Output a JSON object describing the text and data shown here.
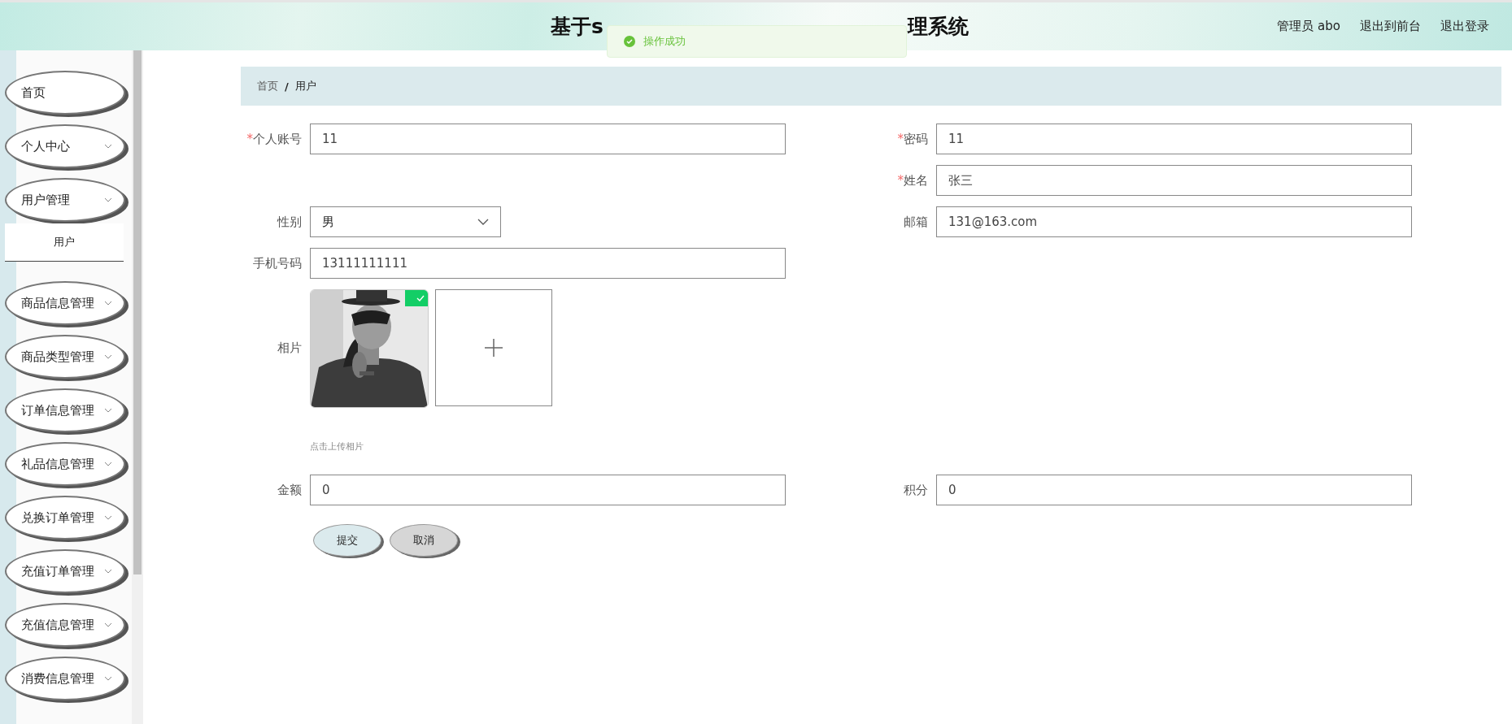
{
  "header": {
    "title_parts": [
      "基于s",
      "理系统"
    ],
    "user_label": "管理员 abo",
    "links": [
      "退出到前台",
      "退出登录"
    ]
  },
  "toast": {
    "message": "操作成功"
  },
  "sidebar": {
    "items": [
      {
        "label": "首页",
        "kind": "link"
      },
      {
        "label": "个人中心",
        "kind": "menu"
      },
      {
        "label": "用户管理",
        "kind": "menu",
        "children": [
          {
            "label": "用户"
          }
        ]
      },
      {
        "label": "商品信息管理",
        "kind": "menu"
      },
      {
        "label": "商品类型管理",
        "kind": "menu"
      },
      {
        "label": "订单信息管理",
        "kind": "menu"
      },
      {
        "label": "礼品信息管理",
        "kind": "menu"
      },
      {
        "label": "兑换订单管理",
        "kind": "menu"
      },
      {
        "label": "充值订单管理",
        "kind": "menu"
      },
      {
        "label": "充值信息管理",
        "kind": "menu"
      },
      {
        "label": "消费信息管理",
        "kind": "menu"
      }
    ]
  },
  "breadcrumb": {
    "items": [
      "首页",
      "用户"
    ],
    "separator": "/"
  },
  "form": {
    "rows": [
      {
        "left": [
          {
            "kind": "text",
            "label": "个人账号",
            "required_mark": "*",
            "value": "11"
          }
        ],
        "right": [
          {
            "kind": "text",
            "label": "密码",
            "required_mark": "*",
            "value": "11"
          },
          {
            "kind": "text",
            "label": "姓名",
            "required_mark": "*",
            "value": "张三"
          }
        ]
      },
      {
        "left": [
          {
            "kind": "select",
            "label": "性别",
            "value": "男"
          }
        ],
        "right": [
          {
            "kind": "text",
            "label": "邮箱",
            "value": "131@163.com"
          }
        ]
      },
      {
        "left": [
          {
            "kind": "text",
            "label": "手机号码",
            "value": "13111111111"
          }
        ]
      },
      {
        "left": [
          {
            "kind": "upload",
            "label": "相片",
            "uploaded": true,
            "hint": "点击上传相片"
          }
        ]
      },
      {
        "left": [
          {
            "kind": "text",
            "label": "金额",
            "value": "0"
          }
        ],
        "right": [
          {
            "kind": "text",
            "label": "积分",
            "value": "0"
          }
        ]
      }
    ],
    "buttons": [
      {
        "label": "提交",
        "kind": "primary"
      },
      {
        "label": "取消",
        "kind": "secondary"
      }
    ]
  }
}
